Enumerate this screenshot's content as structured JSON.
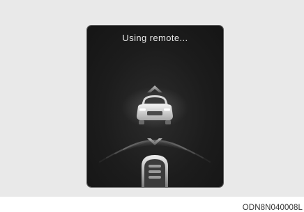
{
  "screen": {
    "status_text": "Using remote..."
  },
  "icons": {
    "front_car": "car-front-view-icon",
    "direction_up": "chevron-up-icon",
    "direction_down": "chevron-down-icon",
    "key_fob": "remote-key-icon",
    "signal": "signal-waves-icon"
  },
  "colors": {
    "screen_background": "#1c1c1c",
    "panel_background": "#e9e9e9",
    "status_text": "#e8e8e8"
  },
  "caption": "ODN8N040008L"
}
